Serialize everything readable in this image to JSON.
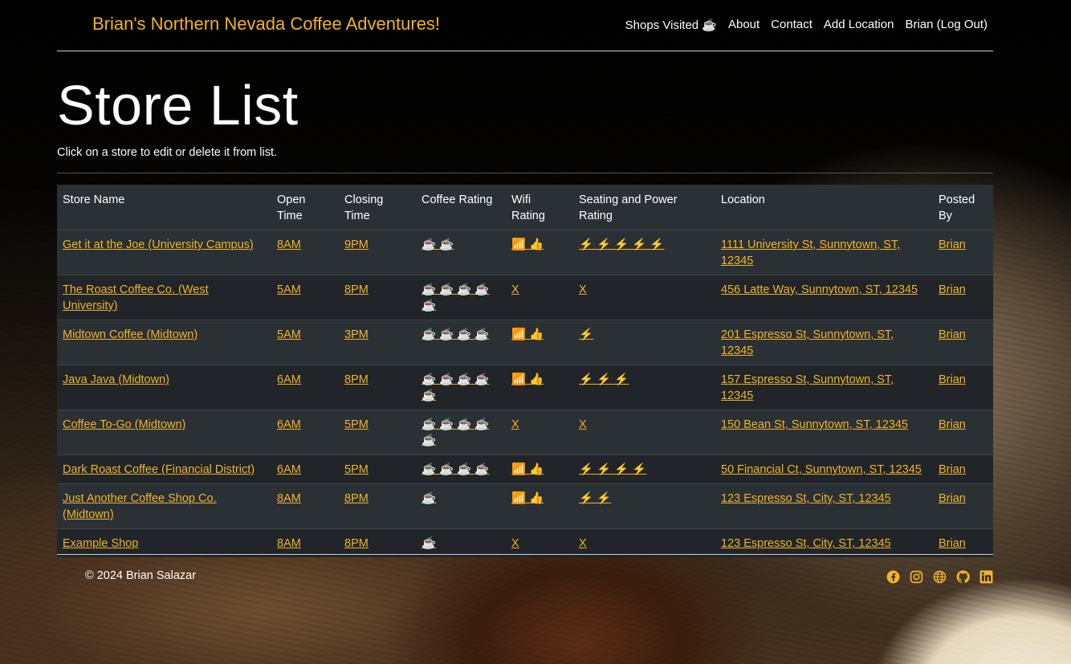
{
  "header": {
    "brand": "Brian's Northern Nevada Coffee Adventures!",
    "nav": [
      {
        "label": "Shops Visited ☕"
      },
      {
        "label": "About"
      },
      {
        "label": "Contact"
      },
      {
        "label": "Add Location"
      },
      {
        "label": "Brian (Log Out)"
      }
    ]
  },
  "page": {
    "title": "Store List",
    "subtitle": "Click on a store to edit or delete it from list."
  },
  "table": {
    "headers": [
      "Store Name",
      "Open Time",
      "Closing Time",
      "Coffee Rating",
      "Wifi Rating",
      "Seating and Power Rating",
      "Location",
      "Posted By"
    ],
    "rows": [
      {
        "name": "Get it at the Joe (University Campus)",
        "open": "8AM",
        "close": "9PM",
        "coffee": "☕ ☕",
        "wifi": "📶 👍",
        "seating": "⚡ ⚡ ⚡ ⚡ ⚡",
        "location": "1111 University St, Sunnytown, ST, 12345",
        "posted": "Brian"
      },
      {
        "name": "The Roast Coffee Co. (West University)",
        "open": "5AM",
        "close": "8PM",
        "coffee": "☕ ☕ ☕ ☕ ☕",
        "wifi": "X",
        "seating": "X",
        "location": "456 Latte Way, Sunnytown, ST, 12345",
        "posted": "Brian"
      },
      {
        "name": "Midtown Coffee (Midtown)",
        "open": "5AM",
        "close": "3PM",
        "coffee": "☕ ☕ ☕ ☕",
        "wifi": "📶 👍",
        "seating": "⚡",
        "location": "201 Espresso St, Sunnytown, ST, 12345",
        "posted": "Brian"
      },
      {
        "name": "Java Java (Midtown)",
        "open": "6AM",
        "close": "8PM",
        "coffee": "☕ ☕ ☕ ☕ ☕",
        "wifi": "📶 👍",
        "seating": "⚡ ⚡ ⚡",
        "location": "157 Espresso St, Sunnytown, ST, 12345",
        "posted": "Brian"
      },
      {
        "name": "Coffee To-Go (Midtown)",
        "open": "6AM",
        "close": "5PM",
        "coffee": "☕ ☕ ☕ ☕ ☕",
        "wifi": "X",
        "seating": "X",
        "location": "150 Bean St, Sunnytown, ST, 12345",
        "posted": "Brian"
      },
      {
        "name": "Dark Roast Coffee (Financial District)",
        "open": "6AM",
        "close": "5PM",
        "coffee": "☕ ☕ ☕ ☕",
        "wifi": "📶 👍",
        "seating": "⚡ ⚡ ⚡ ⚡",
        "location": "50 Financial Ct, Sunnytown, ST, 12345",
        "posted": "Brian"
      },
      {
        "name": "Just Another Coffee Shop Co. (Midtown)",
        "open": "8AM",
        "close": "8PM",
        "coffee": "☕",
        "wifi": "📶 👍",
        "seating": "⚡ ⚡",
        "location": "123 Espresso St, City, ST, 12345",
        "posted": "Brian"
      },
      {
        "name": "Example Shop",
        "open": "8AM",
        "close": "8PM",
        "coffee": "☕",
        "wifi": "X",
        "seating": "X",
        "location": "123 Espresso St, City, ST, 12345",
        "posted": "Brian"
      }
    ]
  },
  "footer": {
    "copyright": "© 2024 Brian Salazar",
    "social_icons": [
      "facebook-icon",
      "instagram-icon",
      "globe-icon",
      "github-icon",
      "linkedin-icon"
    ],
    "accent": "#f0b429"
  }
}
